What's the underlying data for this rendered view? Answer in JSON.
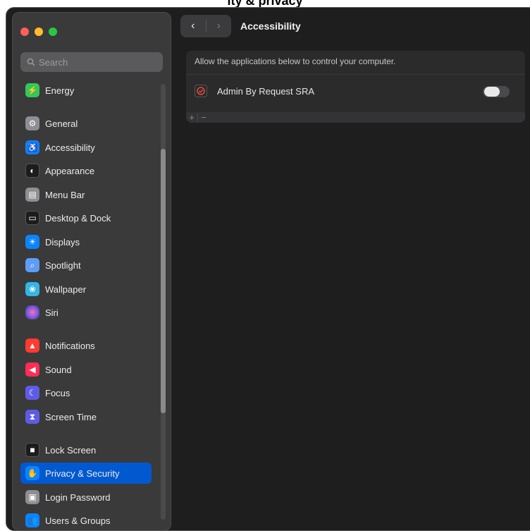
{
  "top_title": "ity & privacy",
  "toolbar": {
    "back": "‹",
    "forward": "›",
    "title": "Accessibility"
  },
  "search": {
    "placeholder": "Search"
  },
  "sidebar": {
    "items": [
      {
        "label": "Energy",
        "color": "#34c759",
        "glyph": "⚡"
      },
      {
        "label": "General",
        "color": "#8e8e93",
        "glyph": "⚙"
      },
      {
        "label": "Accessibility",
        "color": "#0a84ff",
        "glyph": "♿"
      },
      {
        "label": "Appearance",
        "color": "#1c1c1e",
        "glyph": "◐"
      },
      {
        "label": "Menu Bar",
        "color": "#8e8e93",
        "glyph": "▤"
      },
      {
        "label": "Desktop & Dock",
        "color": "#1c1c1e",
        "glyph": "▭"
      },
      {
        "label": "Displays",
        "color": "#0a84ff",
        "glyph": "☀"
      },
      {
        "label": "Spotlight",
        "color": "#5e9cf5",
        "glyph": "⌕"
      },
      {
        "label": "Wallpaper",
        "color": "#33b5e5",
        "glyph": "❀"
      },
      {
        "label": "Siri",
        "color": "#6e5bd6",
        "glyph": "●"
      },
      {
        "label": "Notifications",
        "color": "#ff3b30",
        "glyph": "🔔"
      },
      {
        "label": "Sound",
        "color": "#ff2d55",
        "glyph": "🔊"
      },
      {
        "label": "Focus",
        "color": "#5e5ce6",
        "glyph": "☾"
      },
      {
        "label": "Screen Time",
        "color": "#5e5ce6",
        "glyph": "⧗"
      },
      {
        "label": "Lock Screen",
        "color": "#1c1c1e",
        "glyph": "🔒"
      },
      {
        "label": "Privacy & Security",
        "color": "#0a84ff",
        "glyph": "✋"
      },
      {
        "label": "Login Password",
        "color": "#8e8e93",
        "glyph": "🔑"
      },
      {
        "label": "Users & Groups",
        "color": "#0a84ff",
        "glyph": "👥"
      }
    ]
  },
  "panel": {
    "description": "Allow the applications below to control your computer.",
    "apps": [
      {
        "name": "Admin By Request SRA",
        "enabled": false
      }
    ],
    "add": "+",
    "remove": "−"
  }
}
